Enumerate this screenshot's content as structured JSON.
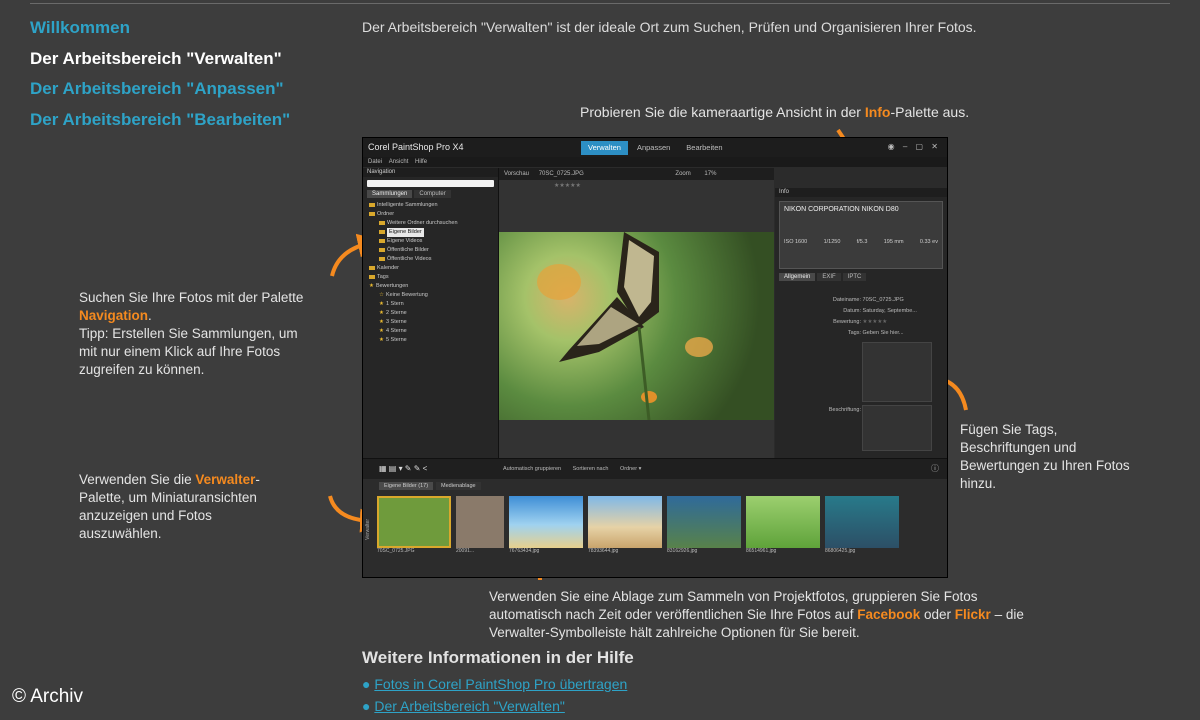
{
  "left_nav": [
    {
      "label": "Willkommen",
      "active": false
    },
    {
      "label": "Der Arbeitsbereich \"Verwalten\"",
      "active": true
    },
    {
      "label": "Der Arbeitsbereich \"Anpassen\"",
      "active": false
    },
    {
      "label": "Der Arbeitsbereich \"Bearbeiten\"",
      "active": false
    }
  ],
  "intro": "Der Arbeitsbereich \"Verwalten\" ist der ideale Ort zum Suchen, Prüfen und Organisieren Ihrer Fotos.",
  "annotations": {
    "info": {
      "before": "Probieren Sie die kameraartige Ansicht in der ",
      "highlight": "Info",
      "after": "-Palette aus."
    },
    "navigation": {
      "line1": "Suchen Sie Ihre Fotos mit der Palette",
      "highlight": "Navigation",
      "after": ".",
      "tip1": "Tipp: Erstellen Sie Sammlungen, um",
      "tip2": "mit nur einem Klick auf Ihre Fotos",
      "tip3": "zugreifen zu können."
    },
    "tags": {
      "line1": "Fügen Sie Tags,",
      "line2": "Beschriftungen und",
      "line3": "Bewertungen zu Ihren Fotos",
      "line4": "hinzu."
    },
    "verwalter": {
      "before": "Verwenden Sie die ",
      "highlight": "Verwalter",
      "after": "-",
      "line2": "Palette, um Miniaturansichten",
      "line3": "anzuzeigen und Fotos",
      "line4": "auszuwählen."
    },
    "ablage": {
      "line1": "Verwenden Sie eine Ablage zum Sammeln von Projektfotos, gruppieren Sie Fotos",
      "line2a": "automatisch nach Zeit oder veröffentlichen Sie Ihre Fotos auf ",
      "facebook": "Facebook",
      "mid": " oder ",
      "flickr": "Flickr",
      "line2b": " – die",
      "line3": "Verwalter-Symbolleiste hält zahlreiche Optionen für Sie bereit."
    }
  },
  "app": {
    "brand": "Corel PaintShop Pro X4",
    "tabs": [
      "Verwalten",
      "Anpassen",
      "Bearbeiten"
    ],
    "menu": [
      "Datei",
      "Ansicht",
      "Hilfe"
    ],
    "nav_title": "Navigation",
    "subtabs": [
      "Sammlungen",
      "Computer"
    ],
    "tree": [
      "Intelligente Sammlungen",
      "Ordner",
      "Weitere Ordner durchsuchen",
      "Eigene Bilder",
      "Eigene Videos",
      "Öffentliche Bilder",
      "Öffentliche Videos",
      "Kalender",
      "Tags",
      "Bewertungen",
      "Keine Bewertung",
      "1 Stern",
      "2 Sterne",
      "3 Sterne",
      "4 Sterne",
      "5 Sterne"
    ],
    "preview_label": "Vorschau",
    "preview_file": "70SC_0725.JPG",
    "zoom_label": "Zoom",
    "zoom_value": "17%",
    "info_title": "Info",
    "camera": "NIKON CORPORATION NIKON D80",
    "exif": [
      "ISO 1600",
      "1/1250",
      "f/5.3",
      "195 mm",
      "0.33 ev"
    ],
    "info_tabs": [
      "Allgemein",
      "EXIF",
      "IPTC"
    ],
    "info_fields": [
      {
        "label": "Dateiname:",
        "value": "70SC_0725.JPG"
      },
      {
        "label": "Datum:",
        "value": "Saturday, Septembe..."
      },
      {
        "label": "Bewertung:",
        "value": "★★★★★"
      },
      {
        "label": "Tags:",
        "value": "Geben Sie hier..."
      },
      {
        "label": "Beschriftung:",
        "value": ""
      }
    ],
    "toolbar": [
      "Automatisch gruppieren",
      "Sortieren nach",
      "Ordner ▾"
    ],
    "bottom_tabs": [
      "Eigene Bilder (17)",
      "Medienablage"
    ],
    "thumbs": [
      {
        "cap": "70SC_0725.JPG",
        "color": "#6f9b3c"
      },
      {
        "cap": "20091...",
        "color": "#8a7a6a"
      },
      {
        "cap": "76763434.jpg",
        "color": "#3e8ed6"
      },
      {
        "cap": "78393644.jpg",
        "color": "#c9a46c"
      },
      {
        "cap": "83162926.jpg",
        "color": "#2f6a9a"
      },
      {
        "cap": "86514961.jpg",
        "color": "#5fa33a"
      },
      {
        "cap": "86806425.jpg",
        "color": "#287a8a"
      }
    ],
    "side_label": "Verwalter"
  },
  "more_title": "Weitere Informationen in der Hilfe",
  "help_links": [
    "Fotos in Corel PaintShop Pro übertragen",
    "Der Arbeitsbereich \"Verwalten\""
  ],
  "credit": "© Archiv"
}
